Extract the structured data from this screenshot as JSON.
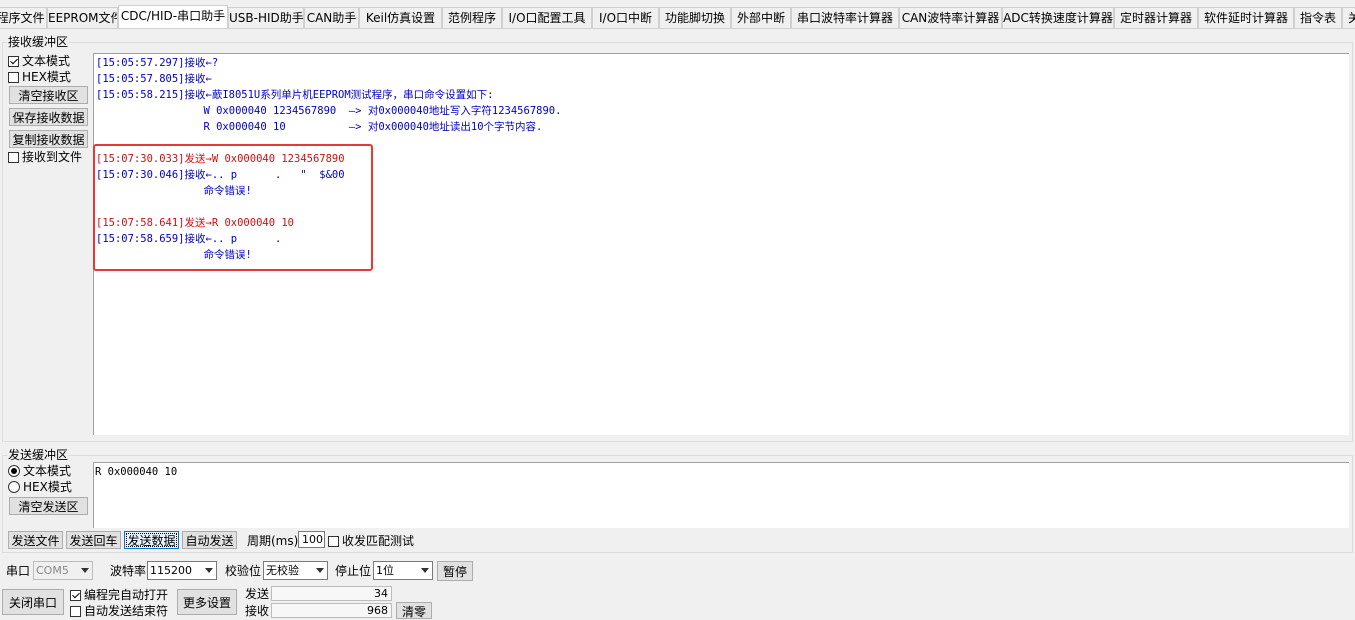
{
  "tabs": [
    {
      "label": "程序文件"
    },
    {
      "label": "EEPROM文件"
    },
    {
      "label": "CDC/HID-串口助手"
    },
    {
      "label": "USB-HID助手"
    },
    {
      "label": "CAN助手"
    },
    {
      "label": "Keil仿真设置"
    },
    {
      "label": "范例程序"
    },
    {
      "label": "I/O口配置工具"
    },
    {
      "label": "I/O口中断"
    },
    {
      "label": "功能脚切换"
    },
    {
      "label": "外部中断"
    },
    {
      "label": "串口波特率计算器"
    },
    {
      "label": "CAN波特率计算器"
    },
    {
      "label": "ADC转换速度计算器"
    },
    {
      "label": "定时器计算器"
    },
    {
      "label": "软件延时计算器"
    },
    {
      "label": "指令表"
    },
    {
      "label": "关"
    }
  ],
  "receive": {
    "group_title": "接收缓冲区",
    "text_mode": "文本模式",
    "hex_mode": "HEX模式",
    "clear": "清空接收区",
    "save": "保存接收数据",
    "copy": "复制接收数据",
    "to_file": "接收到文件",
    "lines": [
      "[15:05:57.297]接收←?",
      "[15:05:57.805]接收←",
      "[15:05:58.215]接收←藃I8051U系列单片机EEPROM测试程序，串口命令设置如下:",
      "                 W 0x000040 1234567890  —> 对0x000040地址写入字符1234567890.",
      "                 R 0x000040 10          —> 对0x000040地址读出10个字节内容.",
      "",
      "[15:07:30.033]发送→W 0x000040 1234567890",
      "[15:07:30.046]接收←.. p      .   \"  $&00",
      "                 命令错误!",
      "",
      "[15:07:58.641]发送→R 0x000040 10",
      "[15:07:58.659]接收←.. p      .",
      "                 命令错误!"
    ]
  },
  "send": {
    "group_title": "发送缓冲区",
    "text_mode": "文本模式",
    "hex_mode": "HEX模式",
    "clear": "清空发送区",
    "content": "R 0x000040 10",
    "send_file": "发送文件",
    "send_cr": "发送回车",
    "send_data": "发送数据",
    "auto_send": "自动发送",
    "period_label": "周期(ms)",
    "period_value": "100",
    "match_test": "收发匹配测试"
  },
  "serial": {
    "port_label": "串口",
    "port_value": "COM5",
    "baud_label": "波特率",
    "baud_value": "115200",
    "parity_label": "校验位",
    "parity_value": "无校验",
    "stop_label": "停止位",
    "stop_value": "1位",
    "pause": "暂停",
    "close_port": "关闭串口",
    "auto_open": "编程完自动打开",
    "auto_send_end": "自动发送结束符",
    "more_settings": "更多设置",
    "sent_label": "发送",
    "sent_count": "34",
    "recv_label": "接收",
    "recv_count": "968",
    "clear_counts": "清零"
  }
}
